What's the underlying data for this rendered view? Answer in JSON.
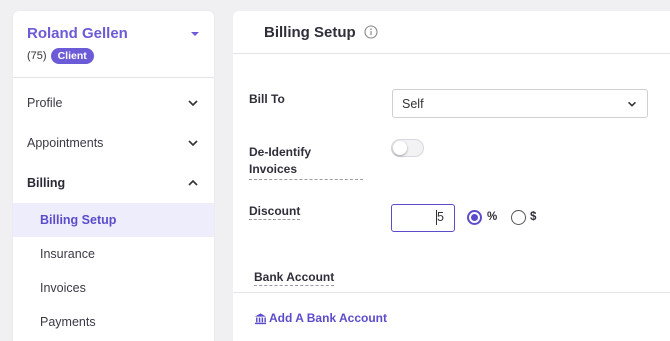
{
  "client": {
    "name": "Roland Gellen",
    "count": "(75)",
    "badge": "Client"
  },
  "nav": {
    "profile": "Profile",
    "appointments": "Appointments",
    "billing": "Billing",
    "billing_sub": [
      "Billing Setup",
      "Insurance",
      "Invoices",
      "Payments"
    ]
  },
  "page": {
    "title": "Billing Setup"
  },
  "form": {
    "bill_to_label": "Bill To",
    "bill_to_value": "Self",
    "deidentify_label_line1": "De-Identify",
    "deidentify_label_line2": "Invoices",
    "deidentify_on": false,
    "discount_label": "Discount",
    "discount_value": "5",
    "percent_label": "%",
    "dollar_label": "$",
    "selected_unit": "%"
  },
  "bank": {
    "section_label": "Bank Account",
    "add_label": "Add A Bank Account"
  },
  "colors": {
    "accent": "#6b5bd6",
    "active_bg": "#eeedfb"
  }
}
